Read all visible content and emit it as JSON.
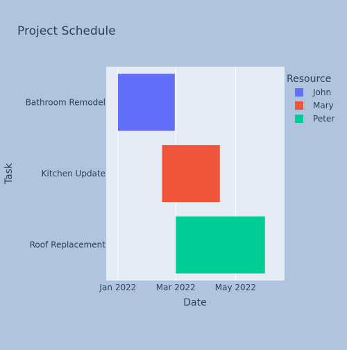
{
  "chart_data": {
    "type": "bar",
    "orientation": "horizontal",
    "chart_kind": "gantt",
    "title": "Project Schedule",
    "xlabel": "Date",
    "ylabel": "Task",
    "x_axis_type": "date",
    "xlim": [
      "2021-12-20",
      "2022-06-20"
    ],
    "x_tick_values": [
      "2022-01-01",
      "2022-03-01",
      "2022-05-01"
    ],
    "x_tick_labels": [
      "Jan 2022",
      "Mar 2022",
      "May 2022"
    ],
    "categories": [
      "Bathroom Remodel",
      "Kitchen Update",
      "Roof Replacement"
    ],
    "legend": {
      "title": "Resource",
      "placement": "right",
      "items": [
        "John",
        "Mary",
        "Peter"
      ]
    },
    "grid": true,
    "colors": {
      "background": "#b0c4de",
      "plot_background": "#e5ecf6",
      "grid": "#ffffff",
      "text": "#2a3f5f",
      "John": "#636efa",
      "Mary": "#ef553b",
      "Peter": "#00cc96"
    },
    "series": [
      {
        "name": "John",
        "values": [
          {
            "task": "Bathroom Remodel",
            "start": "2022-01-01",
            "finish": "2022-02-28"
          }
        ]
      },
      {
        "name": "Mary",
        "values": [
          {
            "task": "Kitchen Update",
            "start": "2022-02-15",
            "finish": "2022-04-15"
          }
        ]
      },
      {
        "name": "Peter",
        "values": [
          {
            "task": "Roof Replacement",
            "start": "2022-03-01",
            "finish": "2022-05-31"
          }
        ]
      }
    ]
  }
}
